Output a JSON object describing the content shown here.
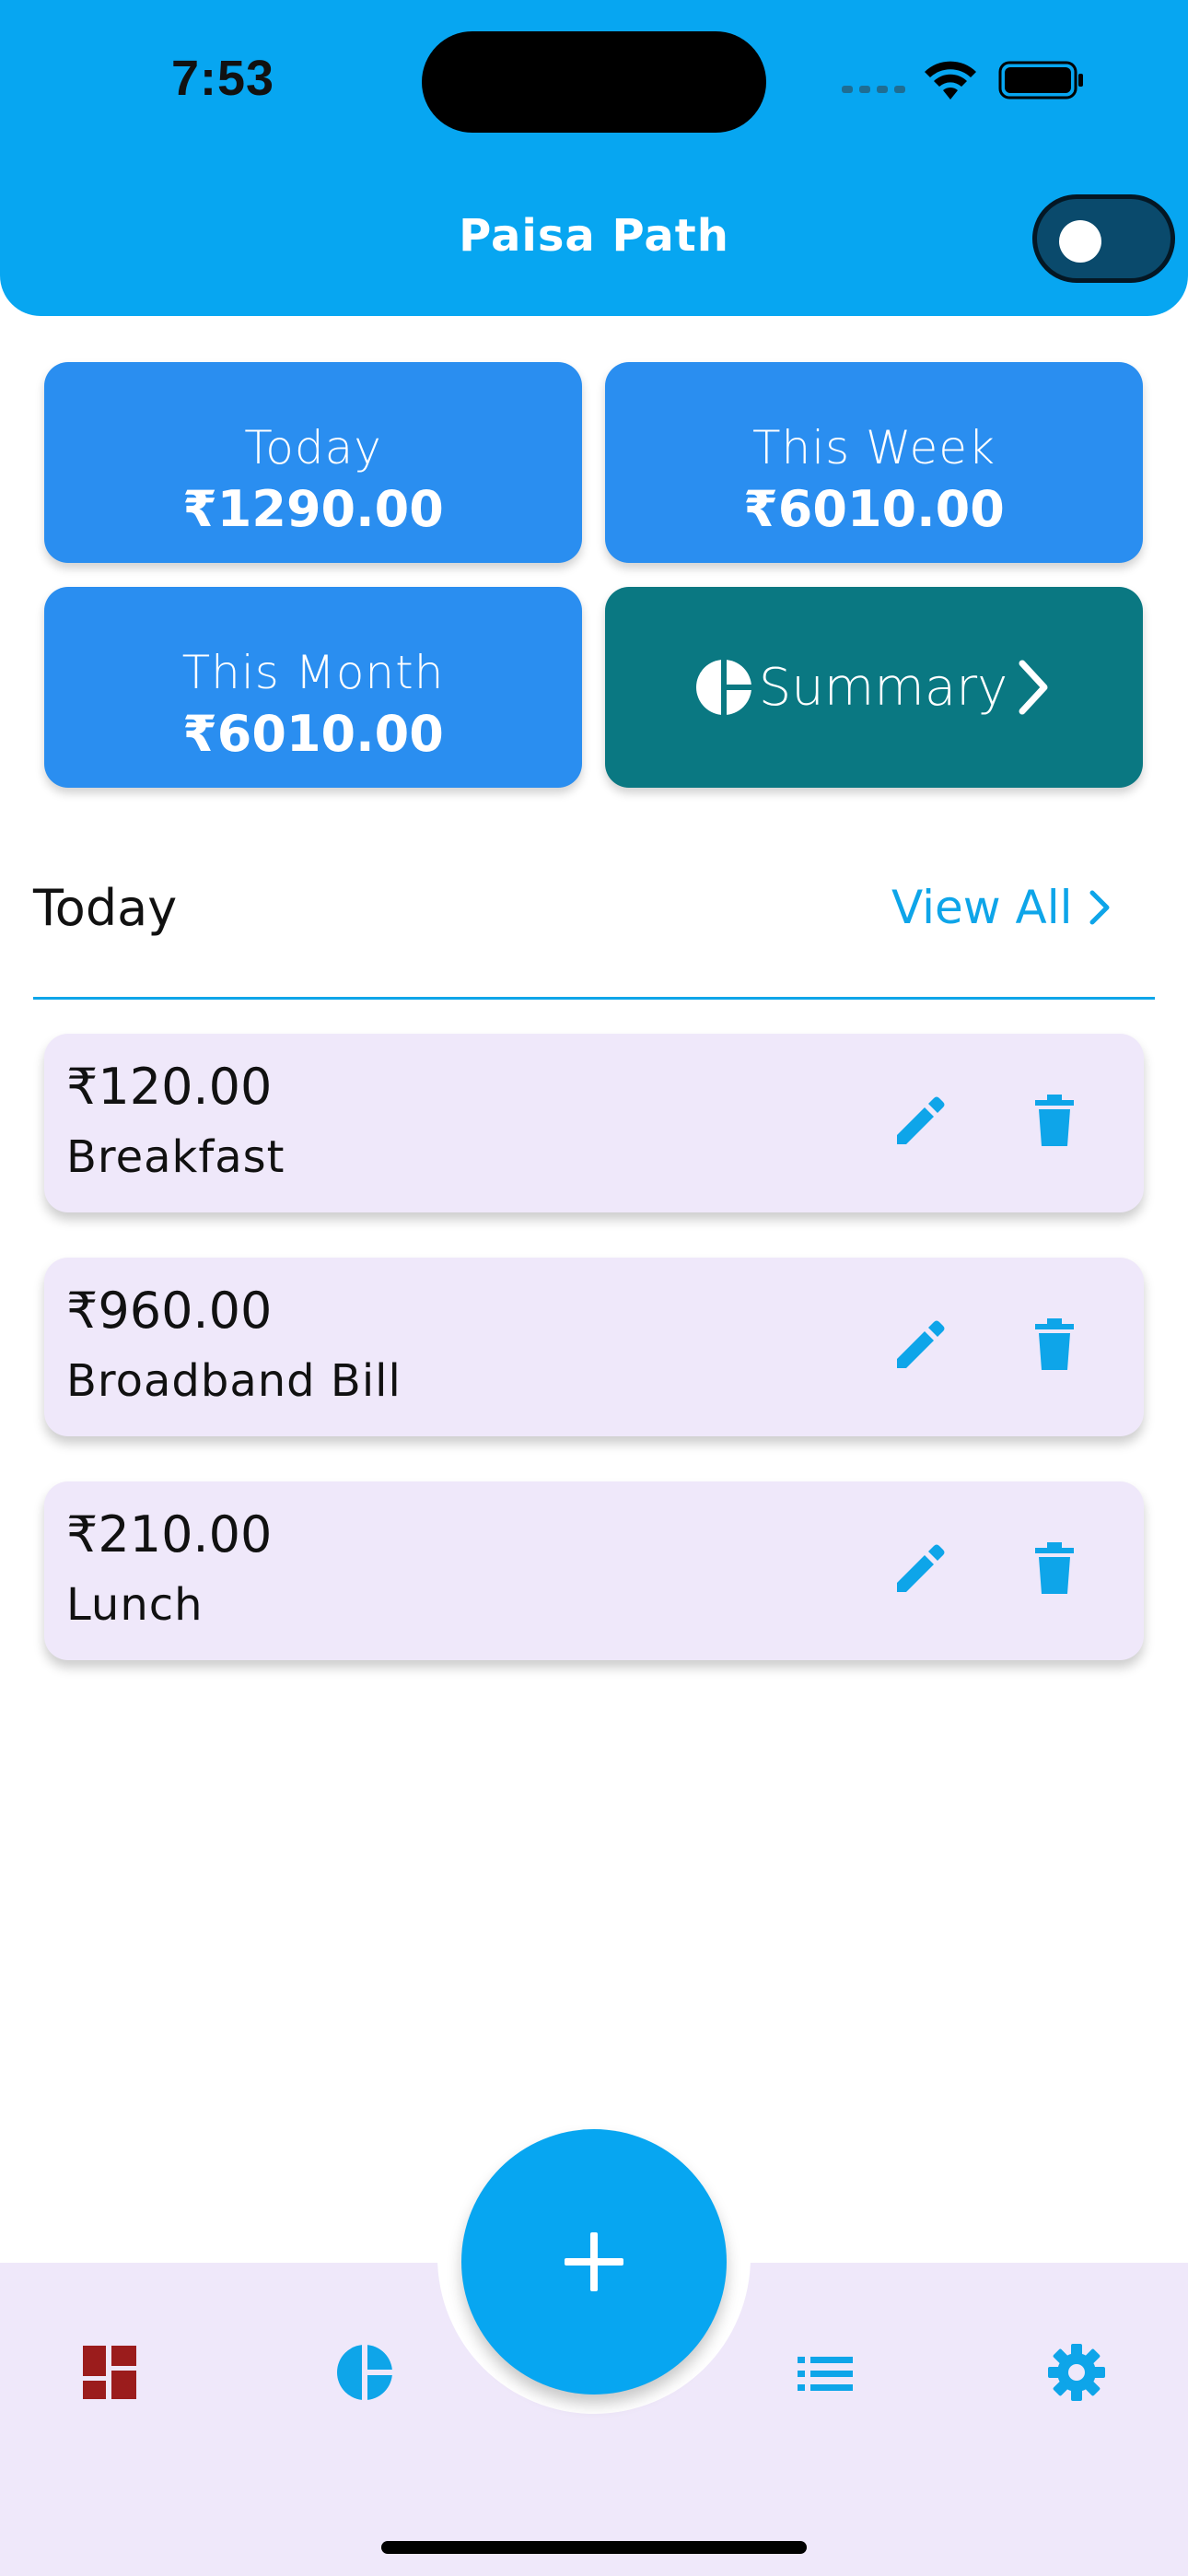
{
  "status_bar": {
    "time": "7:53"
  },
  "header": {
    "title": "Paisa Path",
    "theme_toggle": "off"
  },
  "stats": [
    {
      "label": "Today",
      "value": "₹1290.00"
    },
    {
      "label": "This Week",
      "value": "₹6010.00"
    },
    {
      "label": "This Month",
      "value": "₹6010.00"
    }
  ],
  "summary_card": {
    "label": "Summary",
    "icon": "pie-chart-icon",
    "trailing_icon": "chevron-right-icon"
  },
  "section": {
    "title": "Today",
    "view_all": "View All"
  },
  "expenses": [
    {
      "amount": "₹120.00",
      "name": "Breakfast"
    },
    {
      "amount": "₹960.00",
      "name": "Broadband Bill"
    },
    {
      "amount": "₹210.00",
      "name": "Lunch"
    }
  ],
  "bottom_nav": {
    "items": [
      {
        "icon": "dashboard-icon",
        "active": true
      },
      {
        "icon": "pie-chart-icon",
        "active": false
      },
      {
        "icon": "list-icon",
        "active": false
      },
      {
        "icon": "settings-gear-icon",
        "active": false
      }
    ],
    "fab_icon": "plus-icon"
  },
  "colors": {
    "primary": "#07a6f1",
    "stat_card": "#2a8ef0",
    "summary_card": "#0a7882",
    "row_background": "#efe8fa",
    "active_nav": "#9b1c1c"
  }
}
